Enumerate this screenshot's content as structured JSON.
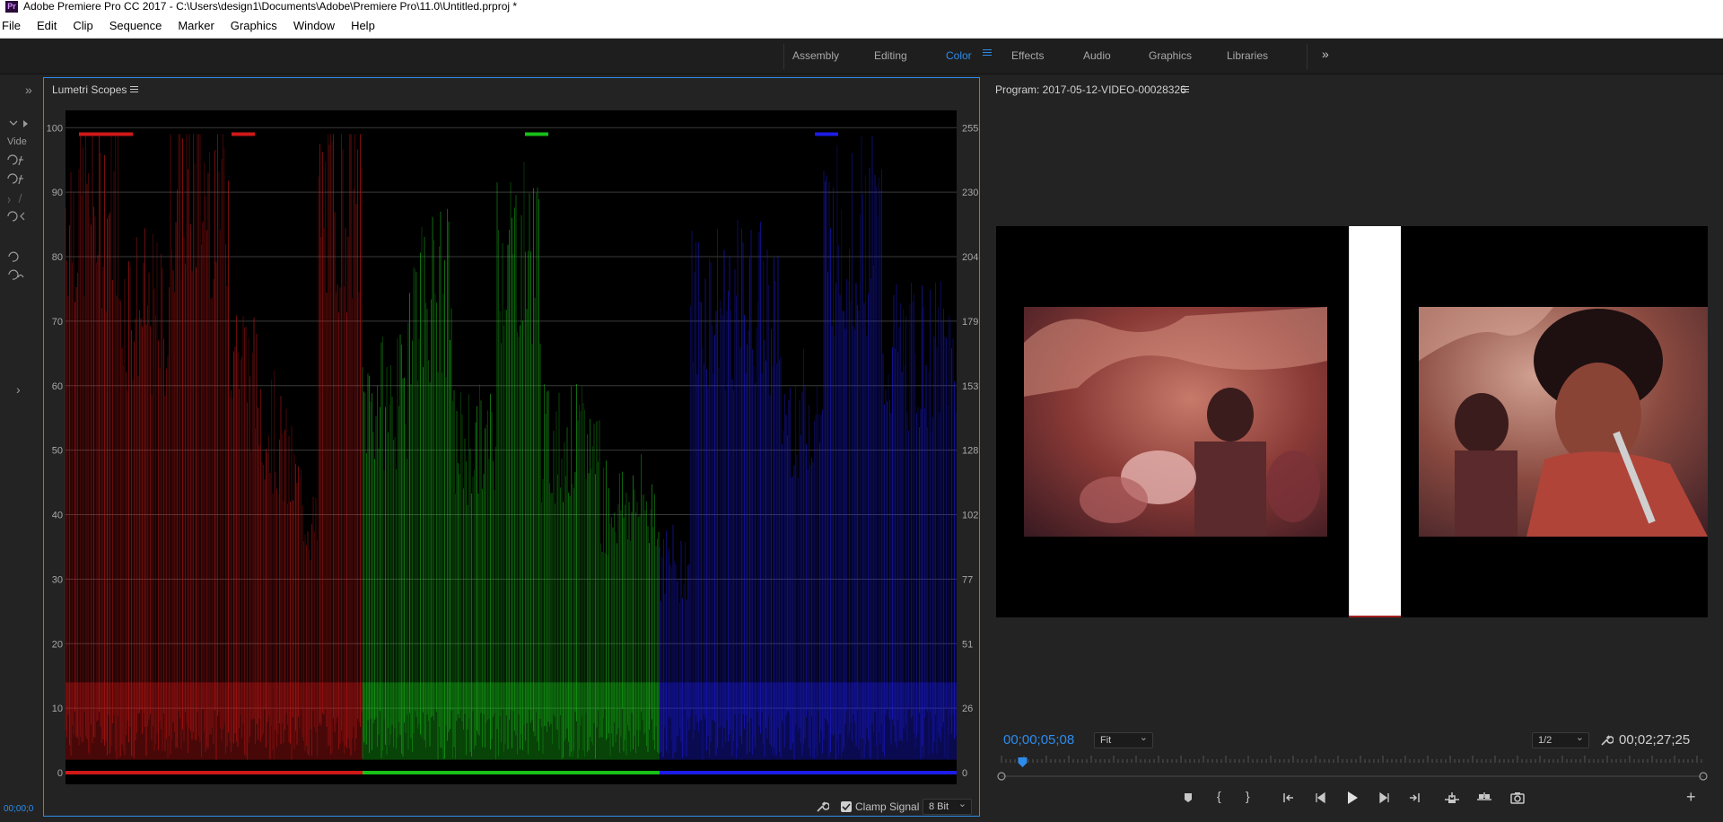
{
  "window": {
    "title": "Adobe Premiere Pro CC 2017 - C:\\Users\\design1\\Documents\\Adobe\\Premiere Pro\\11.0\\Untitled.prproj *",
    "logo": "Pr"
  },
  "menubar": [
    "File",
    "Edit",
    "Clip",
    "Sequence",
    "Marker",
    "Graphics",
    "Window",
    "Help"
  ],
  "workspaces": {
    "tabs": [
      "Assembly",
      "Editing",
      "Color",
      "Effects",
      "Audio",
      "Graphics",
      "Libraries"
    ],
    "active": "Color",
    "more": "»"
  },
  "toolstrip": {
    "collapse": "»",
    "label": "Vide",
    "expand": "›"
  },
  "scopes": {
    "title": "Lumetri Scopes",
    "left_ticks": [
      "100",
      "90",
      "80",
      "70",
      "60",
      "50",
      "40",
      "30",
      "20",
      "10",
      "0"
    ],
    "right_ticks": [
      "255",
      "230",
      "204",
      "179",
      "153",
      "128",
      "102",
      "77",
      "51",
      "26",
      "0"
    ],
    "clamp_label": "Clamp Signal",
    "clamp_checked": true,
    "bit_depth": "8 Bit",
    "channel_colors": {
      "red": "#d01818",
      "green": "#18c018",
      "blue": "#1c1ce8"
    }
  },
  "program": {
    "title": "Program: 2017-05-12-VIDEO-00028326",
    "current_timecode": "00;00;05;08",
    "duration_timecode": "00;02;27;25",
    "zoom": "Fit",
    "resolution": "1/2",
    "playhead_fraction": 0.03
  },
  "status": {
    "timecode": "00;00;0"
  },
  "accent": "#2d8ceb"
}
